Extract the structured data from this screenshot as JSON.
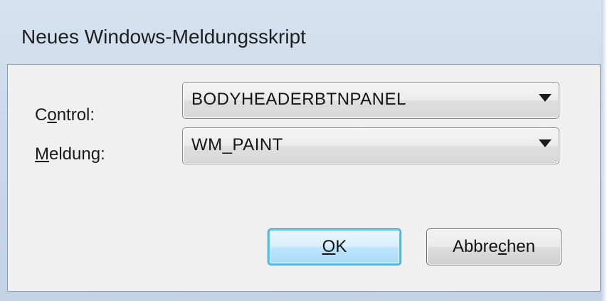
{
  "window": {
    "title": "Neues Windows-Meldungsskript"
  },
  "form": {
    "control_label_pre": "C",
    "control_label_mn": "o",
    "control_label_post": "ntrol:",
    "control_value": "BODYHEADERBTNPANEL",
    "message_label_mn": "M",
    "message_label_post": "eldung:",
    "message_value": "WM_PAINT"
  },
  "buttons": {
    "ok_mn": "O",
    "ok_post": "K",
    "cancel_pre": "Abbre",
    "cancel_mn": "c",
    "cancel_post": "hen"
  },
  "icons": {
    "dropdown": "chevron-down-icon"
  },
  "colors": {
    "default_button_border": "#3c7fb1",
    "default_button_glow": "#48d2fb",
    "client_background": "#f0f0f0"
  }
}
